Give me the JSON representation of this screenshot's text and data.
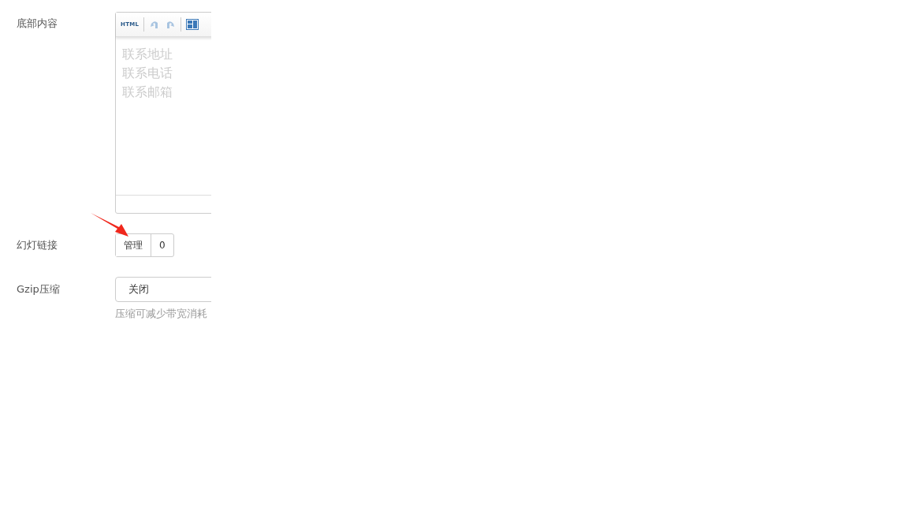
{
  "form": {
    "rows": [
      {
        "kind": "editor",
        "label": "底部内容",
        "toolbar": [
          {
            "kind": "html",
            "text": "HTML",
            "disabled": false
          },
          {
            "kind": "undo",
            "disabled": true
          },
          {
            "kind": "redo",
            "disabled": true
          },
          {
            "kind": "layout",
            "disabled": false
          }
        ],
        "lines": [
          "联系地址",
          "联系电话",
          "联系邮箱"
        ]
      },
      {
        "kind": "counter",
        "label": "幻灯链接",
        "button": "管理",
        "count": "0"
      },
      {
        "kind": "select",
        "label": "Gzip压缩",
        "value": "关闭",
        "hint": "压缩可减少带宽消耗"
      }
    ]
  }
}
